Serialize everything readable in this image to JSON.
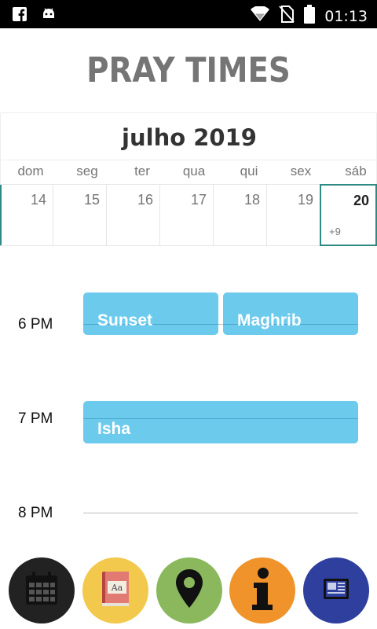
{
  "status_bar": {
    "time": "01:13",
    "icons": [
      "facebook-icon",
      "android-icon",
      "wifi-icon",
      "no-sim-icon",
      "battery-icon"
    ]
  },
  "app": {
    "title": "PRAY TIMES"
  },
  "calendar": {
    "month_title": "julho 2019",
    "weekdays": [
      "dom",
      "seg",
      "ter",
      "qua",
      "qui",
      "sex",
      "sáb"
    ],
    "days": [
      {
        "num": "14"
      },
      {
        "num": "15"
      },
      {
        "num": "16"
      },
      {
        "num": "17"
      },
      {
        "num": "18"
      },
      {
        "num": "19"
      },
      {
        "num": "20",
        "more": "+9",
        "today": true
      }
    ],
    "accent_color": "#2e8a84"
  },
  "schedule": {
    "time_labels": [
      "6 PM",
      "7 PM",
      "8 PM"
    ],
    "events": [
      "Sunset",
      "Maghrib",
      "Isha"
    ],
    "event_color": "#6ccaed"
  },
  "bottom_nav": {
    "items": [
      {
        "icon": "calendar-icon",
        "color": "#222222"
      },
      {
        "icon": "dictionary-icon",
        "color": "#f2c94c"
      },
      {
        "icon": "location-pin-icon",
        "color": "#8bb85c"
      },
      {
        "icon": "info-icon",
        "color": "#f0932b"
      },
      {
        "icon": "news-icon",
        "color": "#2f3f9e"
      }
    ]
  }
}
